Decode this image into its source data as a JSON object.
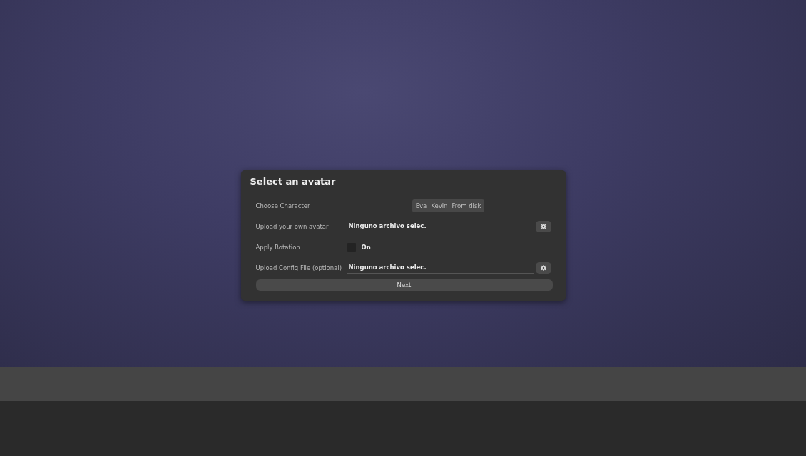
{
  "dialog": {
    "title": "Select an avatar",
    "rows": [
      {
        "kind": "segmented",
        "label": "Choose Character",
        "options": [
          {
            "label": "Eva",
            "selected": false
          },
          {
            "label": "Kevin",
            "selected": false
          },
          {
            "label": "From disk",
            "selected": false
          }
        ]
      },
      {
        "kind": "file",
        "label": "Upload your own avatar",
        "value": "Ninguno archivo selec."
      },
      {
        "kind": "checkbox",
        "label": "Apply Rotation",
        "checked": false,
        "text": "On"
      },
      {
        "kind": "file",
        "label": "Upload Config File (optional)",
        "value": "Ninguno archivo selec."
      }
    ],
    "button": "Next"
  }
}
